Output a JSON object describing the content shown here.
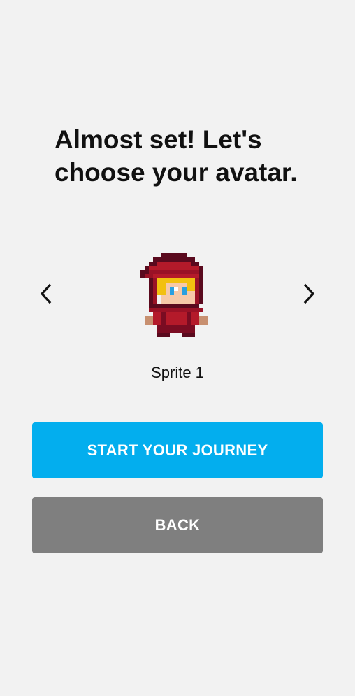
{
  "heading": {
    "line1": "Almost set! Let's",
    "line2": "choose your avatar."
  },
  "carousel": {
    "prev_icon": "chevron-left-icon",
    "next_icon": "chevron-right-icon",
    "selected_sprite": "Sprite 1",
    "sprite_icon": "red-hooded-character-sprite"
  },
  "buttons": {
    "start_label": "START YOUR JOURNEY",
    "back_label": "BACK"
  },
  "colors": {
    "background": "#f2f2f2",
    "primary": "#03aeee",
    "secondary": "#7f7f7f",
    "text": "#111111"
  }
}
